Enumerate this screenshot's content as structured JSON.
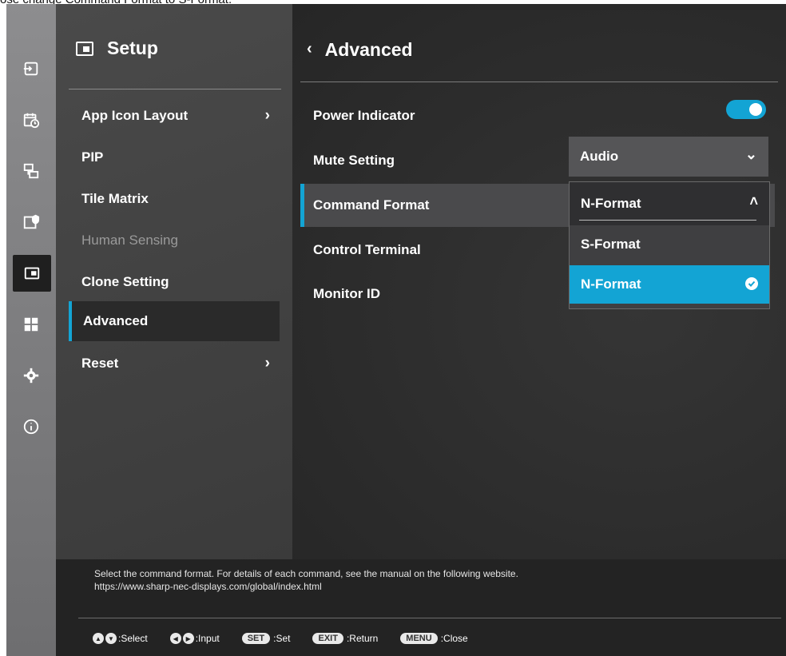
{
  "caption": "ose change Command Format to S-Format.",
  "rail": {
    "icons": [
      "input-icon",
      "schedule-icon",
      "multi-display-icon",
      "protect-icon",
      "setup-icon",
      "apps-icon",
      "settings-icon",
      "info-icon"
    ],
    "active": "setup-icon"
  },
  "setup": {
    "title": "Setup",
    "items": [
      {
        "label": "App Icon Layout",
        "has_chevron": true
      },
      {
        "label": "PIP"
      },
      {
        "label": "Tile Matrix"
      },
      {
        "label": "Human Sensing",
        "disabled": true
      },
      {
        "label": "Clone Setting"
      },
      {
        "label": "Advanced",
        "selected": true
      },
      {
        "label": "Reset",
        "has_chevron": true
      }
    ]
  },
  "advanced": {
    "title": "Advanced",
    "back_glyph": "‹",
    "settings": [
      {
        "label": "Power Indicator",
        "type": "toggle",
        "value": "on"
      },
      {
        "label": "Mute Setting",
        "type": "select",
        "value": "Audio"
      },
      {
        "label": "Command Format",
        "type": "select",
        "value": "N-Format",
        "focused": true
      },
      {
        "label": "Control Terminal"
      },
      {
        "label": "Monitor ID"
      }
    ],
    "dropdown": {
      "current": "N-Format",
      "options": [
        "S-Format",
        "N-Format"
      ],
      "selected": "N-Format"
    }
  },
  "help": {
    "line1": "Select the command format. For details of each command, see the manual on the following website.",
    "line2": "https://www.sharp-nec-displays.com/global/index.html"
  },
  "keys": [
    {
      "key": "▲▼",
      "label": ":Select"
    },
    {
      "key": "◀▶",
      "label": ":Input"
    },
    {
      "key": "SET",
      "label": ":Set"
    },
    {
      "key": "EXIT",
      "label": ":Return"
    },
    {
      "key": "MENU",
      "label": ":Close"
    }
  ],
  "colors": {
    "accent": "#13a4d4"
  }
}
